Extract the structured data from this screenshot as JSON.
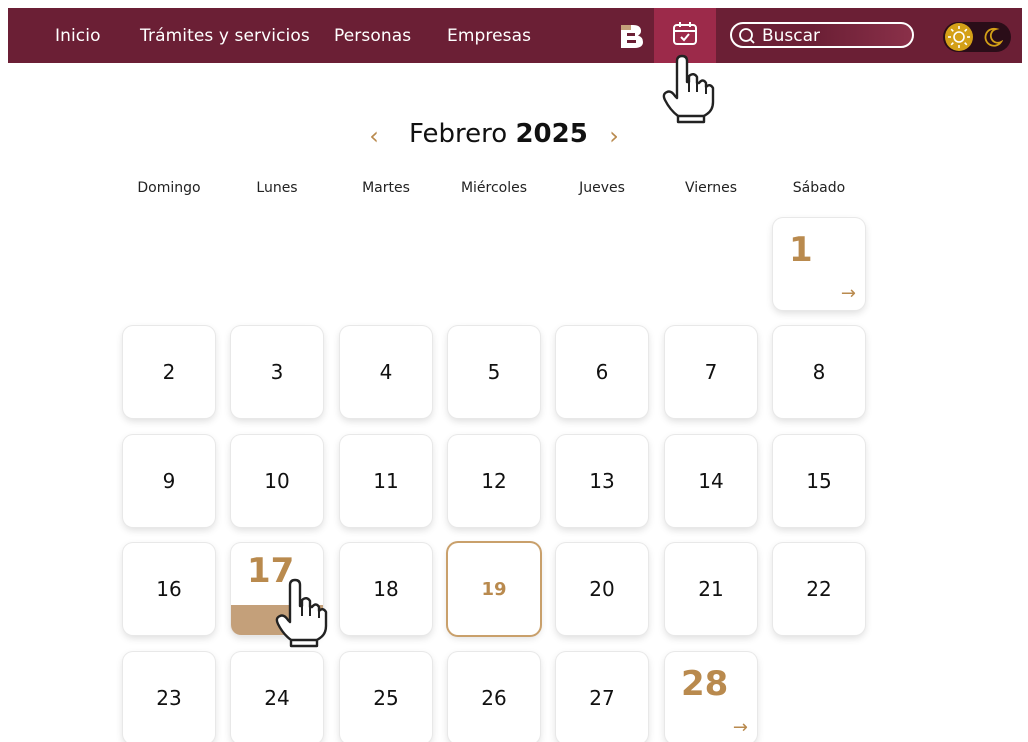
{
  "nav": {
    "links": [
      "Inicio",
      "Trámites y servicios",
      "Personas",
      "Empresas"
    ],
    "search_placeholder": "Buscar"
  },
  "calendar": {
    "month": "Febrero",
    "year": "2025",
    "prev_label": "‹",
    "next_label": "›",
    "weekdays": [
      "Domingo",
      "Lunes",
      "Martes",
      "Miércoles",
      "Jueves",
      "Viernes",
      "Sábado"
    ],
    "days": [
      "1",
      "2",
      "3",
      "4",
      "5",
      "6",
      "7",
      "8",
      "9",
      "10",
      "11",
      "12",
      "13",
      "14",
      "15",
      "16",
      "17",
      "18",
      "19",
      "20",
      "21",
      "22",
      "23",
      "24",
      "25",
      "26",
      "27",
      "28"
    ],
    "event_arrow": "→"
  },
  "colors": {
    "nav_bg": "#6b1f35",
    "nav_active": "#9c2a4a",
    "accent_gold": "#b98a4e",
    "sun": "#d4a017"
  },
  "icons": {
    "logo": "b-logo-icon",
    "calendar": "calendar-check-icon",
    "search": "search-icon",
    "sun": "sun-icon",
    "moon": "moon-icon",
    "cursor": "hand-pointer-icon"
  }
}
